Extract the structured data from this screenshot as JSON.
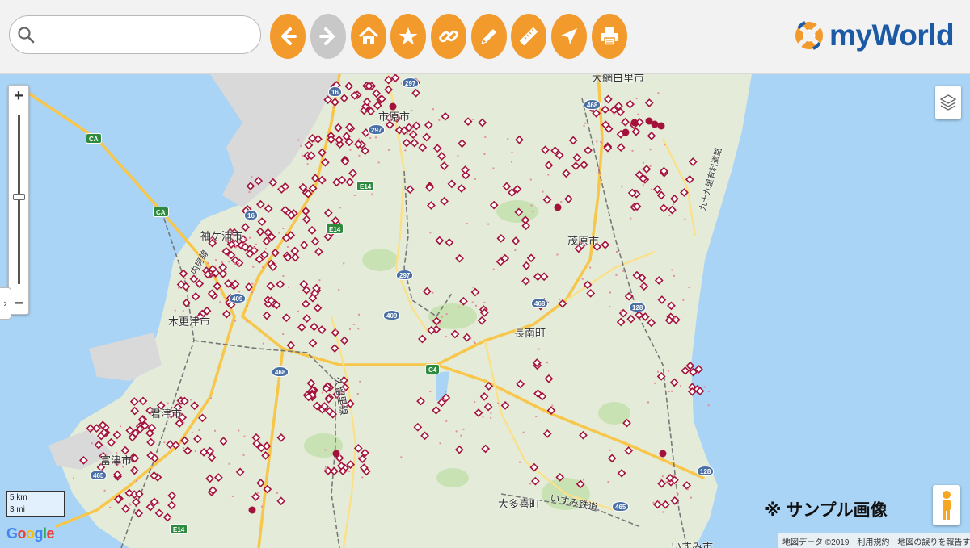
{
  "toolbar": {
    "search_placeholder": "",
    "buttons": [
      {
        "name": "back-button",
        "icon": "arrow-left-icon",
        "state": "active"
      },
      {
        "name": "forward-button",
        "icon": "arrow-right-icon",
        "state": "disabled"
      },
      {
        "name": "home-button",
        "icon": "home-icon",
        "state": "active"
      },
      {
        "name": "favorite-button",
        "icon": "star-icon",
        "state": "active"
      },
      {
        "name": "link-button",
        "icon": "link-icon",
        "state": "active"
      },
      {
        "name": "draw-button",
        "icon": "pencil-icon",
        "state": "active"
      },
      {
        "name": "measure-button",
        "icon": "ruler-icon",
        "state": "active"
      },
      {
        "name": "locate-button",
        "icon": "navigation-arrow-icon",
        "state": "active"
      },
      {
        "name": "print-button",
        "icon": "printer-icon",
        "state": "active"
      }
    ]
  },
  "logo": {
    "text": "myWorld"
  },
  "map": {
    "zoom_in_label": "+",
    "zoom_out_label": "−",
    "side_toggle_label": "›",
    "places": {
      "ichihara": "市原市",
      "sodegaura": "袖ケ浦市",
      "kisarazu": "木更津市",
      "kimitsu": "君津市",
      "futtsu": "富津市",
      "mobara": "茂原市",
      "chonan": "長南町",
      "otaki": "大多喜町",
      "isumi": "いすみ市",
      "oamishirasato": "大網白里市"
    },
    "railways": {
      "uchibo": "内房線",
      "kururi": "久留里線",
      "isumi_railway": "いすみ鉄道",
      "kujukuri": "九十九里有料道路"
    },
    "route_shields": {
      "ca1": "CA",
      "ca2": "CA",
      "e14a": "E14",
      "e14b": "E14",
      "e14c": "E14",
      "c4": "C4",
      "r16a": "16",
      "r16b": "16",
      "r297a": "297",
      "r297b": "297",
      "r297c": "297",
      "r409a": "409",
      "r409b": "409",
      "r468a": "468",
      "r468b": "468",
      "r468c": "468",
      "r128a": "128",
      "r128b": "128",
      "r465a": "465",
      "r465b": "465"
    },
    "scale": {
      "km": "5 km",
      "mi": "3 mi"
    },
    "google": "Google",
    "sample_note": "※ サンプル画像",
    "attribution": {
      "data": "地図データ ©2019",
      "terms": "利用規約",
      "report": "地図の誤りを報告する"
    }
  },
  "colors": {
    "toolbar_accent": "#f39a2c",
    "disabled": "#c8c8c8",
    "logo_blue": "#1c5aa6",
    "water": "#a9d4f5",
    "land": "#e4ecd9",
    "marker": "#a3123a"
  }
}
